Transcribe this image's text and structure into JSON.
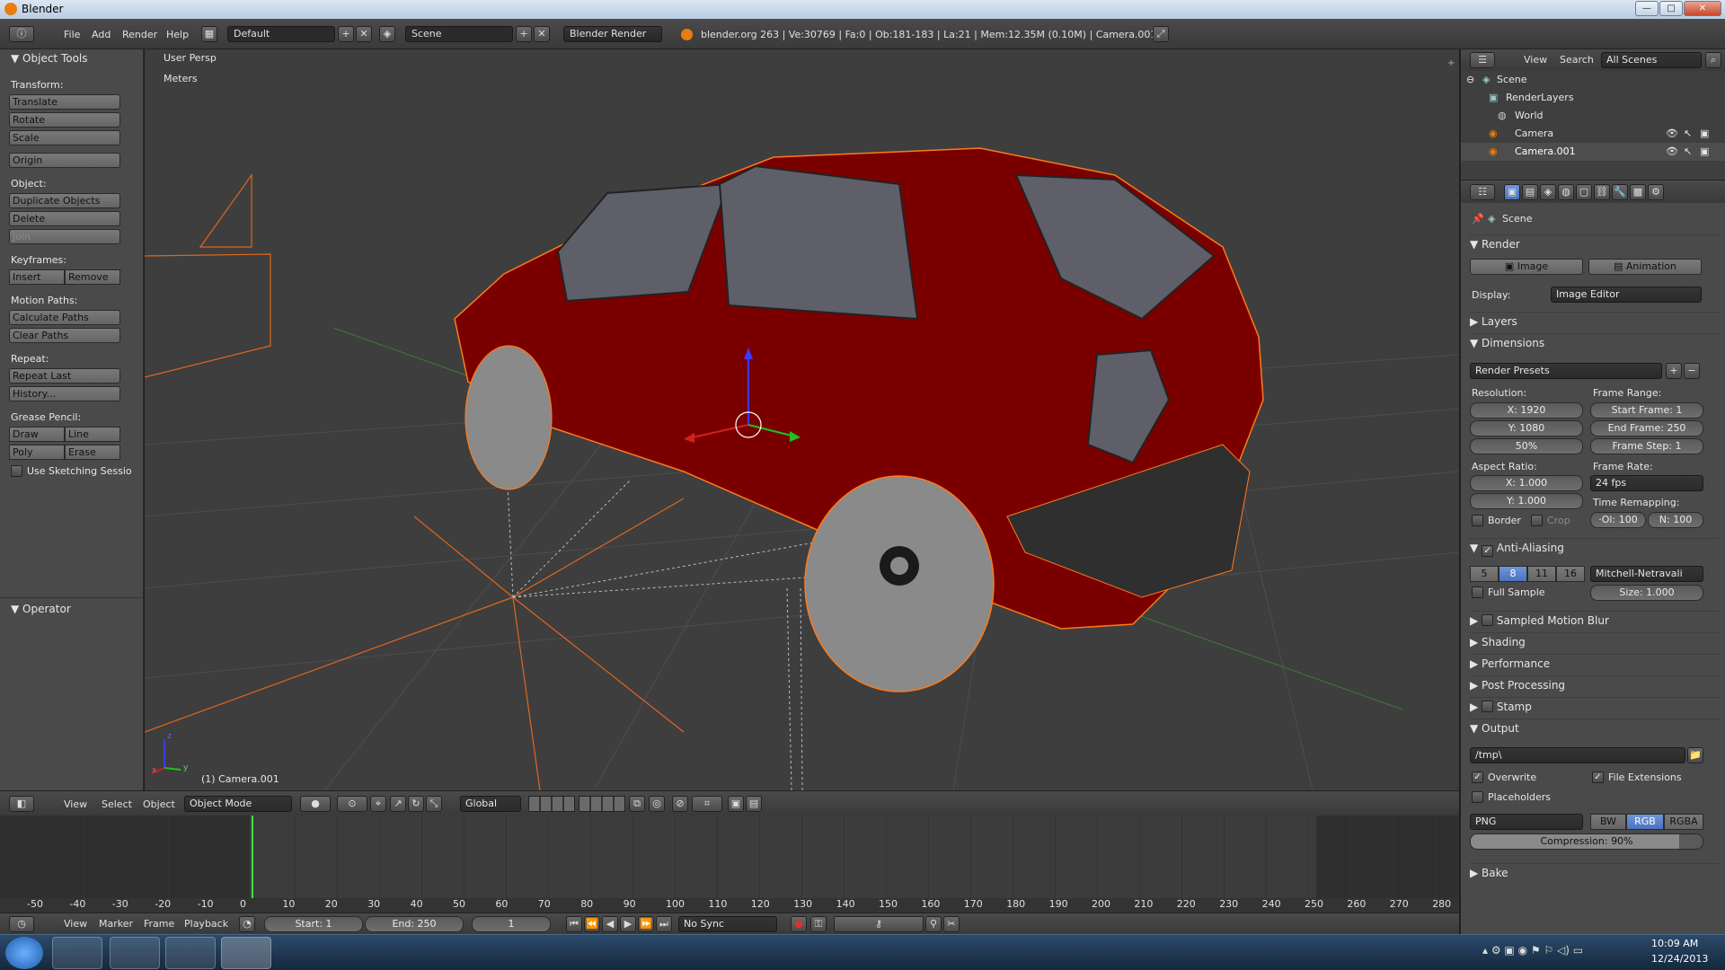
{
  "app": {
    "title": "Blender"
  },
  "window_controls": {
    "minimize": "—",
    "maximize": "□",
    "close": "✕"
  },
  "menu": {
    "file": "File",
    "add": "Add",
    "render": "Render",
    "help": "Help"
  },
  "header": {
    "layout": "Default",
    "scene": "Scene",
    "engine": "Blender Render",
    "info": "blender.org 263 | Ve:30769 | Fa:0 | Ob:181-183 | La:21 | Mem:12.35M (0.10M) | Camera.001"
  },
  "tools": {
    "title": "Object Tools",
    "transform_label": "Transform:",
    "translate": "Translate",
    "rotate": "Rotate",
    "scale": "Scale",
    "origin": "Origin",
    "object_label": "Object:",
    "duplicate": "Duplicate Objects",
    "delete": "Delete",
    "join": "Join",
    "keyframes_label": "Keyframes:",
    "insert": "Insert",
    "remove": "Remove",
    "motion_label": "Motion Paths:",
    "calc_paths": "Calculate Paths",
    "clear_paths": "Clear Paths",
    "repeat_label": "Repeat:",
    "repeat_last": "Repeat Last",
    "history": "History...",
    "grease_label": "Grease Pencil:",
    "draw": "Draw",
    "line": "Line",
    "poly": "Poly",
    "erase": "Erase",
    "sketching": "Use Sketching Sessio",
    "operator": "Operator"
  },
  "viewport": {
    "persp": "User Persp",
    "units": "Meters",
    "object": "(1) Camera.001",
    "axis_x": "x",
    "axis_y": "y",
    "axis_z": "z"
  },
  "vp_header": {
    "view": "View",
    "select": "Select",
    "object": "Object",
    "mode": "Object Mode",
    "orientation": "Global"
  },
  "timeline": {
    "ticks": [
      "-50",
      "-40",
      "-30",
      "-20",
      "-10",
      "0",
      "10",
      "20",
      "30",
      "40",
      "50",
      "60",
      "70",
      "80",
      "90",
      "100",
      "110",
      "120",
      "130",
      "140",
      "150",
      "160",
      "170",
      "180",
      "190",
      "200",
      "210",
      "220",
      "230",
      "240",
      "250",
      "260",
      "270",
      "280"
    ],
    "current_frame_value": 1,
    "start_frame_value": 1,
    "end_frame_value": 250
  },
  "tl_header": {
    "view": "View",
    "marker": "Marker",
    "frame": "Frame",
    "playback": "Playback",
    "start": "Start: 1",
    "end": "End: 250",
    "current": "1",
    "sync": "No Sync"
  },
  "outliner": {
    "view": "View",
    "search": "Search",
    "filter": "All Scenes",
    "items": [
      "Scene",
      "RenderLayers",
      "World",
      "Camera",
      "Camera.001"
    ]
  },
  "props": {
    "scene": "Scene",
    "render_section": "Render",
    "image_btn": "Image",
    "animation_btn": "Animation",
    "display_label": "Display:",
    "display_value": "Image Editor",
    "layers": "Layers",
    "dimensions": "Dimensions",
    "presets": "Render Presets",
    "resolution_label": "Resolution:",
    "res_x": "X: 1920",
    "res_y": "Y: 1080",
    "res_pct": "50%",
    "frame_range_label": "Frame Range:",
    "start_frame": "Start Frame: 1",
    "end_frame": "End Frame: 250",
    "frame_step": "Frame Step: 1",
    "aspect_label": "Aspect Ratio:",
    "asp_x": "X: 1.000",
    "asp_y": "Y: 1.000",
    "frame_rate_label": "Frame Rate:",
    "fps": "24 fps",
    "border": "Border",
    "crop": "Crop",
    "remap_label": "Time Remapping:",
    "remap_old": "·Ol: 100",
    "remap_new": "N: 100",
    "aa": "Anti-Aliasing",
    "aa_samples": [
      "5",
      "8",
      "11",
      "16"
    ],
    "aa_filter": "Mitchell-Netravali",
    "full_sample": "Full Sample",
    "aa_size": "Size: 1.000",
    "motion_blur": "Sampled Motion Blur",
    "shading": "Shading",
    "performance": "Performance",
    "post": "Post Processing",
    "stamp": "Stamp",
    "output": "Output",
    "output_path": "/tmp\\",
    "overwrite": "Overwrite",
    "file_ext": "File Extensions",
    "placeholders": "Placeholders",
    "format": "PNG",
    "bw": "BW",
    "rgb": "RGB",
    "rgba": "RGBA",
    "compression": "Compression: 90%",
    "compression_value": 90,
    "bake": "Bake"
  },
  "taskbar": {
    "time": "10:09 AM",
    "date": "12/24/2013"
  },
  "colors": {
    "accent": "#e87d0d",
    "selected": "#5680c2",
    "car_body": "#7a0000",
    "outline": "#ff7a1a"
  }
}
